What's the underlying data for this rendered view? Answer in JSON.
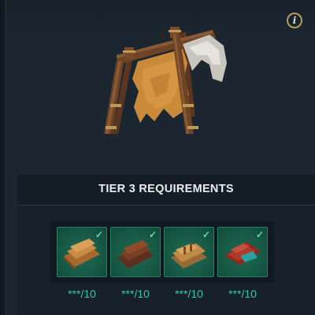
{
  "header": {
    "info_icon_label": "i"
  },
  "hero": {
    "icon": "leather-drying-rack"
  },
  "requirements": {
    "title": "TIER 3 REQUIREMENTS",
    "items": [
      {
        "icon": "leather-planks-icon",
        "quantity": "***/10",
        "completed": true
      },
      {
        "icon": "dark-leather-icon",
        "quantity": "***/10",
        "completed": true
      },
      {
        "icon": "tan-leather-icon",
        "quantity": "***/10",
        "completed": true
      },
      {
        "icon": "red-leather-icon",
        "quantity": "***/10",
        "completed": true
      }
    ],
    "check_glyph": "✓"
  },
  "colors": {
    "slot_bg": "#175a46",
    "check": "#59e0b5",
    "quantity_text": "#35c9a0",
    "title_text": "#e9edf0",
    "info_ring": "#b99a57"
  }
}
